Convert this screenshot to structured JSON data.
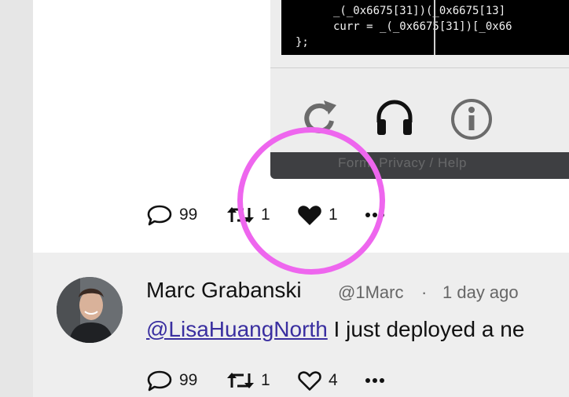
{
  "media": {
    "code_lines": [
      "_(_0x6675[31])(_0x6675[13]",
      "curr = _(_0x6675[31])[_0x66",
      "};"
    ],
    "footer_text": "Form: Privacy / Help"
  },
  "post": {
    "actions": {
      "comments": "99",
      "retweets": "1",
      "likes": "1"
    }
  },
  "reply": {
    "author_name": "Marc Grabanski",
    "handle": "@1Marc",
    "separator": "·",
    "timestamp": "1 day ago",
    "mention": "@LisaHuangNorth",
    "body": " I just deployed a ne",
    "actions": {
      "comments": "99",
      "retweets": "1",
      "likes": "4"
    }
  },
  "colors": {
    "highlight": "#ee66ee",
    "mention": "#3a2fa0"
  }
}
